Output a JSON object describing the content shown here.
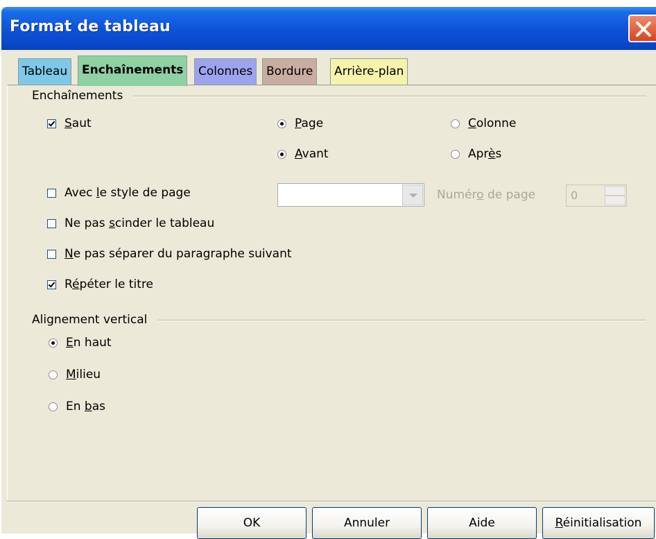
{
  "window": {
    "title": "Format de tableau"
  },
  "tabs": [
    {
      "label": "Tableau",
      "color": "#7fc8e8"
    },
    {
      "label": "Enchaînements",
      "color": "#8ed1a3",
      "active": true
    },
    {
      "label": "Colonnes",
      "color": "#9ea3ee"
    },
    {
      "label": "Bordure",
      "color": "#c9ada0"
    },
    {
      "label": "Arrière-plan",
      "color": "#f6f3ac"
    }
  ],
  "flow": {
    "group_label": "Enchaînements",
    "saut": {
      "label": "Saut",
      "checked": true
    },
    "page": {
      "label": "Page",
      "selected": true
    },
    "colonne": {
      "label": "Colonne",
      "selected": false
    },
    "avant": {
      "label": "Avant",
      "selected": true
    },
    "apres": {
      "label": "Après",
      "selected": false
    },
    "page_style": {
      "label": "Avec le style de page",
      "checked": false,
      "value": ""
    },
    "page_number": {
      "label": "Numéro de page",
      "value": "0"
    },
    "no_split": {
      "label": "Ne pas scinder le tableau",
      "checked": false
    },
    "keep_next": {
      "label": "Ne pas séparer du paragraphe suivant",
      "checked": false
    },
    "repeat_heading": {
      "label": "Répéter le titre",
      "checked": true
    }
  },
  "valign": {
    "group_label": "Alignement vertical",
    "top": {
      "label": "En haut",
      "selected": true
    },
    "middle": {
      "label": "Milieu",
      "selected": false
    },
    "bottom": {
      "label": "En bas",
      "selected": false
    }
  },
  "buttons": {
    "ok": "OK",
    "cancel": "Annuler",
    "help": "Aide",
    "reset": "Réinitialisation"
  }
}
